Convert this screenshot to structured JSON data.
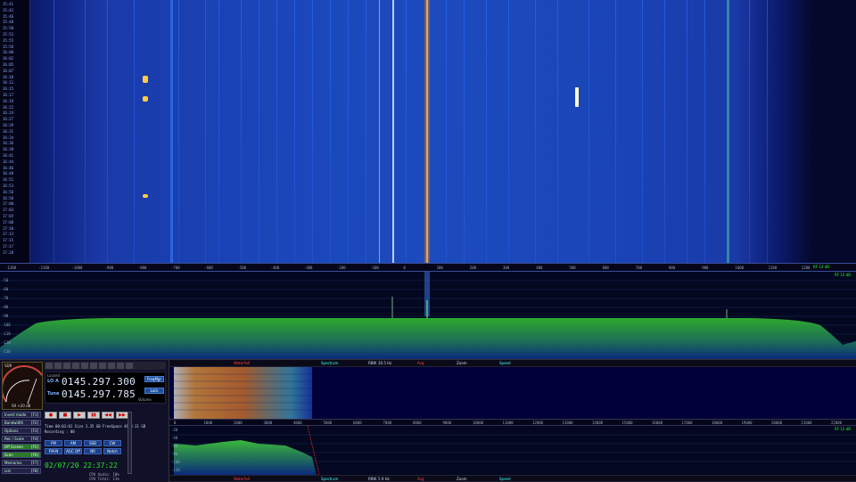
{
  "waterfall": {
    "time_labels": [
      "15:41",
      "15:43",
      "15:46",
      "15:48",
      "15:50",
      "15:53",
      "15:55",
      "15:58",
      "16:00",
      "16:02",
      "16:05",
      "16:07",
      "16:10",
      "16:12",
      "16:15",
      "16:17",
      "16:19",
      "16:22",
      "16:24",
      "16:27",
      "16:29",
      "16:31",
      "16:34",
      "16:36",
      "16:39",
      "16:41",
      "16:44",
      "16:46",
      "16:48",
      "16:51",
      "16:53",
      "16:56",
      "16:58",
      "17:00",
      "17:03",
      "17:05",
      "17:08",
      "17:10",
      "17:13",
      "17:15",
      "17:17",
      "17:20"
    ],
    "freq_ticks": [
      "-1200",
      "-1100",
      "-1000",
      "-900",
      "-800",
      "-700",
      "-600",
      "-500",
      "-400",
      "-300",
      "-200",
      "-100",
      "0",
      "100",
      "200",
      "300",
      "400",
      "500",
      "600",
      "700",
      "800",
      "900",
      "1000",
      "1100",
      "1200"
    ],
    "right_tag": "RF 12 dB"
  },
  "spectrum": {
    "db_labels": [
      "-50",
      "-60",
      "-70",
      "-80",
      "-90",
      "-100",
      "-110",
      "-120",
      "-130"
    ],
    "tag": "RF 12 dB"
  },
  "left_panel": {
    "smeter_label": "S9 +20 dB",
    "brand": "SDR",
    "side_buttons": [
      {
        "label": "Invert mode",
        "key": "[F1]",
        "active": false
      },
      {
        "label": "Bandwidth",
        "key": "[F2]",
        "active": false
      },
      {
        "label": "Options",
        "key": "[F3]",
        "active": false
      },
      {
        "label": "Rec / Scale",
        "key": "[F4]",
        "active": false
      },
      {
        "label": "Off Screen",
        "key": "[F5]",
        "active": true
      },
      {
        "label": "Scan",
        "key": "[F6]",
        "active": true
      },
      {
        "label": "Memories",
        "key": "[F7]",
        "active": false
      },
      {
        "label": "List",
        "key": "[F8]",
        "active": false
      }
    ],
    "freq": {
      "locked_label": "Locked",
      "lo_tag": "LO A",
      "lo_value": "0145.297.300",
      "tune_tag": "Tune",
      "tune_value": "0145.297.785",
      "volume_label": "Volume",
      "freq_mgr": "FreqMgr",
      "lock_btn": "Lock"
    },
    "transport": [
      "●",
      "■",
      "▶",
      "▮▮",
      "◀◀",
      "▶▶"
    ],
    "rec_lines": [
      "Time 00:03:01  Size 3.35 GB  FreeSpace 4623.31 GB",
      "Recording : 00"
    ],
    "mode_row1": [
      "FM",
      "AM",
      "SSB",
      "CW"
    ],
    "mode_row2": [
      "FM-N",
      "AGC Off",
      "NR",
      "Notch"
    ],
    "clock": "02/07/20 22:37:22",
    "stat_lines": [
      "CPU Audio: 10%",
      "CPU Total: 11%"
    ]
  },
  "sub": {
    "top_bar": {
      "waterfall": "Waterfall",
      "spectrum": "Spectrum",
      "rbw_label": "RBW",
      "rbw_value": "30.5 Hz",
      "avg": "Avg",
      "zoom": "Zoom",
      "speed": "Speed"
    },
    "bottom_bar": {
      "waterfall": "Waterfall",
      "spectrum": "Spectrum",
      "rbw_label": "RBW",
      "rbw_value": "5.9 Hz",
      "avg": "Avg",
      "zoom": "Zoom",
      "speed": "Speed"
    },
    "axis_ticks": [
      "0",
      "1000",
      "2000",
      "3000",
      "4000",
      "5000",
      "6000",
      "7000",
      "8000",
      "9000",
      "10000",
      "11000",
      "12000",
      "13000",
      "14000",
      "15000",
      "16000",
      "17000",
      "18000",
      "19000",
      "20000",
      "21000",
      "22000"
    ],
    "spec_tag": "RF 12 dB",
    "spec_labels": [
      "-20",
      "-40",
      "-60",
      "-80",
      "-100",
      "-120"
    ]
  }
}
